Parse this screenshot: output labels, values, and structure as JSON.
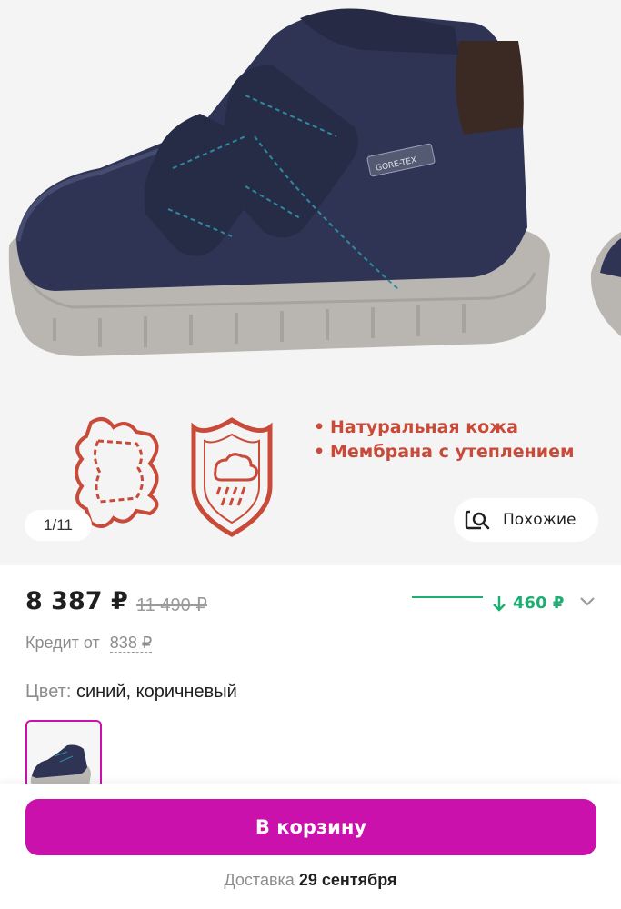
{
  "gallery": {
    "counter": "1/11",
    "similar_label": "Похожие",
    "features": [
      "Натуральная кожа",
      "Мембрана с утеплением"
    ],
    "badge_text": "GORE-TEX"
  },
  "price": {
    "current": "8 387 ₽",
    "old": "11 490 ₽",
    "drop": "460 ₽",
    "drop_color": "#1daf72"
  },
  "credit": {
    "label": "Кредит от",
    "amount": "838 ₽"
  },
  "color": {
    "label": "Цвет:",
    "value": "синий, коричневый"
  },
  "cart": {
    "label": "В корзину",
    "color": "#cb11ab"
  },
  "delivery": {
    "label": "Доставка",
    "date": "29 сентября"
  }
}
